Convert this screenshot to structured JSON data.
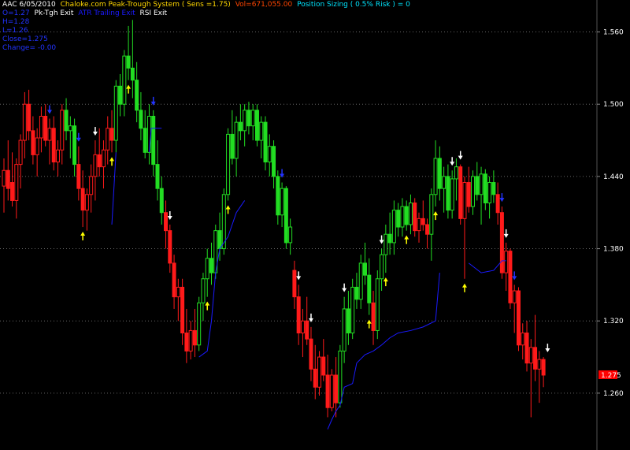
{
  "header": {
    "line1": {
      "symbol_date": "AAC 6/05/2010",
      "system": "Chaloke.com Peak-Trough System ( Sens =1.75)",
      "volume": "Vol=671,055.00",
      "sizing": "Position Sizing ( 0.5% Risk ) = 0"
    },
    "line2": {
      "o": "O=1.27",
      "pk_exit": "Pk-Tgh Exit",
      "atr_exit": "ATR Trailing Exit",
      "rsi_exit": "RSI Exit"
    },
    "ohlc": [
      "H=1.28",
      "L=1.26",
      "Close=1.275",
      "Change= -0.00"
    ]
  },
  "colors": {
    "background": "#000000",
    "up": "#22dd22",
    "down": "#ff1a1a",
    "trail": "#1a1aff",
    "buy_arrow": "#ffff00",
    "sell_arrow": "#ffffff",
    "blue_arrow": "#2233ff",
    "grid": "#666666",
    "last_price_box": "#ff0000"
  },
  "chart_data": {
    "type": "candlestick",
    "ylim": [
      1.22,
      1.58
    ],
    "y_ticks": [
      "1.560",
      "1.500",
      "1.440",
      "1.380",
      "1.320",
      "1.260"
    ],
    "grid": "dotted horizontal at ticks",
    "last_price": "1.275",
    "candles": [
      {
        "o": 1.432,
        "h": 1.455,
        "l": 1.41,
        "c": 1.445,
        "d": "down"
      },
      {
        "o": 1.445,
        "h": 1.47,
        "l": 1.42,
        "c": 1.43,
        "d": "down"
      },
      {
        "o": 1.435,
        "h": 1.46,
        "l": 1.415,
        "c": 1.42,
        "d": "down"
      },
      {
        "o": 1.42,
        "h": 1.455,
        "l": 1.405,
        "c": 1.45,
        "d": "down"
      },
      {
        "o": 1.45,
        "h": 1.475,
        "l": 1.43,
        "c": 1.47,
        "d": "down"
      },
      {
        "o": 1.47,
        "h": 1.51,
        "l": 1.455,
        "c": 1.5,
        "d": "down"
      },
      {
        "o": 1.5,
        "h": 1.512,
        "l": 1.47,
        "c": 1.478,
        "d": "down"
      },
      {
        "o": 1.478,
        "h": 1.49,
        "l": 1.45,
        "c": 1.458,
        "d": "down"
      },
      {
        "o": 1.458,
        "h": 1.48,
        "l": 1.44,
        "c": 1.472,
        "d": "down"
      },
      {
        "o": 1.472,
        "h": 1.498,
        "l": 1.46,
        "c": 1.49,
        "d": "down"
      },
      {
        "o": 1.49,
        "h": 1.5,
        "l": 1.465,
        "c": 1.47,
        "d": "down"
      },
      {
        "o": 1.47,
        "h": 1.488,
        "l": 1.45,
        "c": 1.48,
        "d": "down"
      },
      {
        "o": 1.48,
        "h": 1.49,
        "l": 1.445,
        "c": 1.452,
        "d": "down"
      },
      {
        "o": 1.452,
        "h": 1.47,
        "l": 1.44,
        "c": 1.462,
        "d": "down"
      },
      {
        "o": 1.462,
        "h": 1.5,
        "l": 1.45,
        "c": 1.495,
        "d": "down"
      },
      {
        "o": 1.495,
        "h": 1.505,
        "l": 1.47,
        "c": 1.478,
        "d": "up"
      },
      {
        "o": 1.478,
        "h": 1.49,
        "l": 1.455,
        "c": 1.482,
        "d": "up"
      },
      {
        "o": 1.482,
        "h": 1.488,
        "l": 1.44,
        "c": 1.45,
        "d": "up"
      },
      {
        "o": 1.45,
        "h": 1.465,
        "l": 1.42,
        "c": 1.43,
        "d": "down"
      },
      {
        "o": 1.43,
        "h": 1.445,
        "l": 1.398,
        "c": 1.412,
        "d": "down"
      },
      {
        "o": 1.412,
        "h": 1.43,
        "l": 1.395,
        "c": 1.425,
        "d": "down"
      },
      {
        "o": 1.425,
        "h": 1.45,
        "l": 1.41,
        "c": 1.44,
        "d": "down"
      },
      {
        "o": 1.44,
        "h": 1.47,
        "l": 1.42,
        "c": 1.458,
        "d": "down"
      },
      {
        "o": 1.458,
        "h": 1.48,
        "l": 1.44,
        "c": 1.448,
        "d": "down"
      },
      {
        "o": 1.448,
        "h": 1.47,
        "l": 1.43,
        "c": 1.462,
        "d": "down"
      },
      {
        "o": 1.462,
        "h": 1.49,
        "l": 1.45,
        "c": 1.48,
        "d": "down"
      },
      {
        "o": 1.48,
        "h": 1.495,
        "l": 1.46,
        "c": 1.47,
        "d": "down"
      },
      {
        "o": 1.47,
        "h": 1.52,
        "l": 1.46,
        "c": 1.515,
        "d": "up"
      },
      {
        "o": 1.515,
        "h": 1.525,
        "l": 1.49,
        "c": 1.5,
        "d": "up"
      },
      {
        "o": 1.5,
        "h": 1.545,
        "l": 1.49,
        "c": 1.54,
        "d": "up"
      },
      {
        "o": 1.54,
        "h": 1.565,
        "l": 1.52,
        "c": 1.53,
        "d": "up"
      },
      {
        "o": 1.53,
        "h": 1.57,
        "l": 1.505,
        "c": 1.52,
        "d": "up"
      },
      {
        "o": 1.52,
        "h": 1.535,
        "l": 1.485,
        "c": 1.495,
        "d": "up"
      },
      {
        "o": 1.495,
        "h": 1.51,
        "l": 1.47,
        "c": 1.48,
        "d": "up"
      },
      {
        "o": 1.48,
        "h": 1.495,
        "l": 1.455,
        "c": 1.46,
        "d": "up"
      },
      {
        "o": 1.46,
        "h": 1.5,
        "l": 1.45,
        "c": 1.49,
        "d": "up"
      },
      {
        "o": 1.49,
        "h": 1.495,
        "l": 1.44,
        "c": 1.45,
        "d": "up"
      },
      {
        "o": 1.45,
        "h": 1.47,
        "l": 1.42,
        "c": 1.43,
        "d": "up"
      },
      {
        "o": 1.43,
        "h": 1.44,
        "l": 1.4,
        "c": 1.41,
        "d": "up"
      },
      {
        "o": 1.41,
        "h": 1.42,
        "l": 1.38,
        "c": 1.395,
        "d": "down"
      },
      {
        "o": 1.395,
        "h": 1.4,
        "l": 1.36,
        "c": 1.368,
        "d": "down"
      },
      {
        "o": 1.368,
        "h": 1.375,
        "l": 1.33,
        "c": 1.34,
        "d": "down"
      },
      {
        "o": 1.34,
        "h": 1.355,
        "l": 1.32,
        "c": 1.348,
        "d": "down"
      },
      {
        "o": 1.348,
        "h": 1.355,
        "l": 1.3,
        "c": 1.31,
        "d": "down"
      },
      {
        "o": 1.31,
        "h": 1.33,
        "l": 1.285,
        "c": 1.295,
        "d": "down"
      },
      {
        "o": 1.295,
        "h": 1.32,
        "l": 1.288,
        "c": 1.312,
        "d": "down"
      },
      {
        "o": 1.312,
        "h": 1.33,
        "l": 1.29,
        "c": 1.3,
        "d": "down"
      },
      {
        "o": 1.3,
        "h": 1.34,
        "l": 1.295,
        "c": 1.335,
        "d": "up"
      },
      {
        "o": 1.335,
        "h": 1.36,
        "l": 1.32,
        "c": 1.355,
        "d": "up"
      },
      {
        "o": 1.355,
        "h": 1.38,
        "l": 1.34,
        "c": 1.372,
        "d": "up"
      },
      {
        "o": 1.372,
        "h": 1.385,
        "l": 1.35,
        "c": 1.36,
        "d": "up"
      },
      {
        "o": 1.36,
        "h": 1.4,
        "l": 1.355,
        "c": 1.395,
        "d": "up"
      },
      {
        "o": 1.395,
        "h": 1.41,
        "l": 1.37,
        "c": 1.38,
        "d": "up"
      },
      {
        "o": 1.38,
        "h": 1.43,
        "l": 1.375,
        "c": 1.425,
        "d": "up"
      },
      {
        "o": 1.425,
        "h": 1.48,
        "l": 1.42,
        "c": 1.475,
        "d": "up"
      },
      {
        "o": 1.475,
        "h": 1.495,
        "l": 1.45,
        "c": 1.455,
        "d": "up"
      },
      {
        "o": 1.455,
        "h": 1.49,
        "l": 1.44,
        "c": 1.485,
        "d": "up"
      },
      {
        "o": 1.485,
        "h": 1.5,
        "l": 1.47,
        "c": 1.478,
        "d": "up"
      },
      {
        "o": 1.478,
        "h": 1.5,
        "l": 1.465,
        "c": 1.495,
        "d": "up"
      },
      {
        "o": 1.495,
        "h": 1.502,
        "l": 1.475,
        "c": 1.482,
        "d": "up"
      },
      {
        "o": 1.482,
        "h": 1.5,
        "l": 1.47,
        "c": 1.495,
        "d": "up"
      },
      {
        "o": 1.495,
        "h": 1.5,
        "l": 1.465,
        "c": 1.47,
        "d": "up"
      },
      {
        "o": 1.47,
        "h": 1.49,
        "l": 1.455,
        "c": 1.485,
        "d": "up"
      },
      {
        "o": 1.485,
        "h": 1.49,
        "l": 1.445,
        "c": 1.452,
        "d": "up"
      },
      {
        "o": 1.452,
        "h": 1.475,
        "l": 1.44,
        "c": 1.465,
        "d": "up"
      },
      {
        "o": 1.465,
        "h": 1.47,
        "l": 1.43,
        "c": 1.44,
        "d": "up"
      },
      {
        "o": 1.44,
        "h": 1.445,
        "l": 1.4,
        "c": 1.408,
        "d": "up"
      },
      {
        "o": 1.408,
        "h": 1.435,
        "l": 1.398,
        "c": 1.43,
        "d": "up"
      },
      {
        "o": 1.43,
        "h": 1.432,
        "l": 1.38,
        "c": 1.385,
        "d": "up"
      },
      {
        "o": 1.385,
        "h": 1.405,
        "l": 1.375,
        "c": 1.398,
        "d": "up"
      },
      {
        "o": 1.362,
        "h": 1.37,
        "l": 1.33,
        "c": 1.34,
        "d": "down"
      },
      {
        "o": 1.34,
        "h": 1.35,
        "l": 1.3,
        "c": 1.31,
        "d": "down"
      },
      {
        "o": 1.31,
        "h": 1.33,
        "l": 1.29,
        "c": 1.32,
        "d": "down"
      },
      {
        "o": 1.32,
        "h": 1.34,
        "l": 1.3,
        "c": 1.305,
        "d": "down"
      },
      {
        "o": 1.305,
        "h": 1.315,
        "l": 1.27,
        "c": 1.28,
        "d": "down"
      },
      {
        "o": 1.28,
        "h": 1.3,
        "l": 1.255,
        "c": 1.265,
        "d": "down"
      },
      {
        "o": 1.265,
        "h": 1.295,
        "l": 1.258,
        "c": 1.29,
        "d": "down"
      },
      {
        "o": 1.29,
        "h": 1.305,
        "l": 1.27,
        "c": 1.275,
        "d": "down"
      },
      {
        "o": 1.275,
        "h": 1.292,
        "l": 1.24,
        "c": 1.248,
        "d": "down"
      },
      {
        "o": 1.248,
        "h": 1.28,
        "l": 1.245,
        "c": 1.275,
        "d": "down"
      },
      {
        "o": 1.275,
        "h": 1.29,
        "l": 1.24,
        "c": 1.252,
        "d": "down"
      },
      {
        "o": 1.252,
        "h": 1.3,
        "l": 1.248,
        "c": 1.295,
        "d": "up"
      },
      {
        "o": 1.295,
        "h": 1.34,
        "l": 1.285,
        "c": 1.33,
        "d": "up"
      },
      {
        "o": 1.33,
        "h": 1.345,
        "l": 1.3,
        "c": 1.31,
        "d": "up"
      },
      {
        "o": 1.31,
        "h": 1.355,
        "l": 1.305,
        "c": 1.348,
        "d": "up"
      },
      {
        "o": 1.348,
        "h": 1.36,
        "l": 1.33,
        "c": 1.338,
        "d": "up"
      },
      {
        "o": 1.338,
        "h": 1.375,
        "l": 1.33,
        "c": 1.368,
        "d": "up"
      },
      {
        "o": 1.368,
        "h": 1.385,
        "l": 1.35,
        "c": 1.358,
        "d": "up"
      },
      {
        "o": 1.358,
        "h": 1.372,
        "l": 1.325,
        "c": 1.335,
        "d": "up"
      },
      {
        "o": 1.335,
        "h": 1.345,
        "l": 1.3,
        "c": 1.312,
        "d": "down"
      },
      {
        "o": 1.312,
        "h": 1.362,
        "l": 1.305,
        "c": 1.355,
        "d": "up"
      },
      {
        "o": 1.355,
        "h": 1.38,
        "l": 1.345,
        "c": 1.375,
        "d": "up"
      },
      {
        "o": 1.375,
        "h": 1.4,
        "l": 1.36,
        "c": 1.392,
        "d": "up"
      },
      {
        "o": 1.392,
        "h": 1.41,
        "l": 1.375,
        "c": 1.385,
        "d": "up"
      },
      {
        "o": 1.385,
        "h": 1.42,
        "l": 1.375,
        "c": 1.412,
        "d": "up"
      },
      {
        "o": 1.412,
        "h": 1.418,
        "l": 1.39,
        "c": 1.398,
        "d": "up"
      },
      {
        "o": 1.398,
        "h": 1.422,
        "l": 1.39,
        "c": 1.415,
        "d": "up"
      },
      {
        "o": 1.415,
        "h": 1.42,
        "l": 1.395,
        "c": 1.4,
        "d": "up"
      },
      {
        "o": 1.4,
        "h": 1.425,
        "l": 1.392,
        "c": 1.418,
        "d": "up"
      },
      {
        "o": 1.418,
        "h": 1.422,
        "l": 1.39,
        "c": 1.395,
        "d": "down"
      },
      {
        "o": 1.395,
        "h": 1.41,
        "l": 1.385,
        "c": 1.405,
        "d": "down"
      },
      {
        "o": 1.405,
        "h": 1.42,
        "l": 1.395,
        "c": 1.4,
        "d": "down"
      },
      {
        "o": 1.4,
        "h": 1.405,
        "l": 1.38,
        "c": 1.392,
        "d": "down"
      },
      {
        "o": 1.392,
        "h": 1.43,
        "l": 1.37,
        "c": 1.425,
        "d": "up"
      },
      {
        "o": 1.425,
        "h": 1.47,
        "l": 1.415,
        "c": 1.455,
        "d": "up"
      },
      {
        "o": 1.455,
        "h": 1.465,
        "l": 1.42,
        "c": 1.43,
        "d": "up"
      },
      {
        "o": 1.43,
        "h": 1.448,
        "l": 1.41,
        "c": 1.44,
        "d": "up"
      },
      {
        "o": 1.44,
        "h": 1.45,
        "l": 1.405,
        "c": 1.412,
        "d": "up"
      },
      {
        "o": 1.412,
        "h": 1.445,
        "l": 1.405,
        "c": 1.438,
        "d": "up"
      },
      {
        "o": 1.438,
        "h": 1.455,
        "l": 1.42,
        "c": 1.448,
        "d": "up"
      },
      {
        "o": 1.448,
        "h": 1.45,
        "l": 1.4,
        "c": 1.405,
        "d": "down"
      },
      {
        "o": 1.405,
        "h": 1.44,
        "l": 1.355,
        "c": 1.435,
        "d": "down"
      },
      {
        "o": 1.435,
        "h": 1.448,
        "l": 1.41,
        "c": 1.415,
        "d": "down"
      },
      {
        "o": 1.415,
        "h": 1.445,
        "l": 1.408,
        "c": 1.44,
        "d": "up"
      },
      {
        "o": 1.44,
        "h": 1.452,
        "l": 1.42,
        "c": 1.425,
        "d": "up"
      },
      {
        "o": 1.425,
        "h": 1.448,
        "l": 1.4,
        "c": 1.442,
        "d": "up"
      },
      {
        "o": 1.442,
        "h": 1.446,
        "l": 1.412,
        "c": 1.418,
        "d": "up"
      },
      {
        "o": 1.418,
        "h": 1.44,
        "l": 1.405,
        "c": 1.435,
        "d": "up"
      },
      {
        "o": 1.435,
        "h": 1.445,
        "l": 1.418,
        "c": 1.425,
        "d": "up"
      },
      {
        "o": 1.425,
        "h": 1.435,
        "l": 1.4,
        "c": 1.41,
        "d": "down"
      },
      {
        "o": 1.41,
        "h": 1.415,
        "l": 1.355,
        "c": 1.36,
        "d": "down"
      },
      {
        "o": 1.36,
        "h": 1.385,
        "l": 1.345,
        "c": 1.378,
        "d": "down"
      },
      {
        "o": 1.378,
        "h": 1.38,
        "l": 1.33,
        "c": 1.335,
        "d": "down"
      },
      {
        "o": 1.335,
        "h": 1.35,
        "l": 1.31,
        "c": 1.345,
        "d": "down"
      },
      {
        "o": 1.345,
        "h": 1.348,
        "l": 1.295,
        "c": 1.3,
        "d": "down"
      },
      {
        "o": 1.3,
        "h": 1.318,
        "l": 1.288,
        "c": 1.31,
        "d": "down"
      },
      {
        "o": 1.31,
        "h": 1.32,
        "l": 1.278,
        "c": 1.285,
        "d": "down"
      },
      {
        "o": 1.285,
        "h": 1.305,
        "l": 1.24,
        "c": 1.298,
        "d": "down"
      },
      {
        "o": 1.298,
        "h": 1.325,
        "l": 1.27,
        "c": 1.28,
        "d": "down"
      },
      {
        "o": 1.28,
        "h": 1.295,
        "l": 1.252,
        "c": 1.288,
        "d": "down"
      },
      {
        "o": 1.288,
        "h": 1.29,
        "l": 1.265,
        "c": 1.275,
        "d": "down"
      }
    ],
    "trailing_stop": [
      [
        0,
        1.4
      ],
      [
        26,
        1.4
      ],
      [
        27,
        1.46
      ],
      [
        35,
        1.46
      ],
      [
        35.5,
        1.48
      ],
      [
        38,
        1.48
      ],
      [
        47,
        1.29
      ],
      [
        49,
        1.295
      ],
      [
        50,
        1.32
      ],
      [
        51,
        1.36
      ],
      [
        52,
        1.38
      ],
      [
        53,
        1.385
      ],
      [
        54,
        1.39
      ],
      [
        55,
        1.4
      ],
      [
        56,
        1.41
      ],
      [
        58,
        1.42
      ],
      [
        65,
        1.42
      ],
      [
        78,
        1.23
      ],
      [
        79,
        1.238
      ],
      [
        80,
        1.245
      ],
      [
        81,
        1.25
      ],
      [
        82,
        1.265
      ],
      [
        84,
        1.268
      ],
      [
        85,
        1.285
      ],
      [
        87,
        1.292
      ],
      [
        89,
        1.295
      ],
      [
        91,
        1.3
      ],
      [
        93,
        1.306
      ],
      [
        95,
        1.31
      ],
      [
        98,
        1.312
      ],
      [
        101,
        1.315
      ],
      [
        104,
        1.32
      ],
      [
        105,
        1.36
      ],
      [
        112,
        1.368
      ],
      [
        115,
        1.36
      ],
      [
        118,
        1.362
      ],
      [
        120,
        1.37
      ],
      [
        121,
        1.37
      ]
    ],
    "arrows": [
      {
        "i": 11,
        "type": "blue-down",
        "side": "above"
      },
      {
        "i": 18,
        "type": "blue-down",
        "side": "above"
      },
      {
        "i": 36,
        "type": "blue-down",
        "side": "above"
      },
      {
        "i": 67,
        "type": "blue-down",
        "side": "above"
      },
      {
        "i": 120,
        "type": "blue-down",
        "side": "above"
      },
      {
        "i": 123,
        "type": "blue-down",
        "side": "above"
      },
      {
        "i": 19,
        "type": "yellow-up",
        "side": "below"
      },
      {
        "i": 26,
        "type": "yellow-up",
        "side": "below"
      },
      {
        "i": 30,
        "type": "yellow-up",
        "side": "below"
      },
      {
        "i": 49,
        "type": "yellow-up",
        "side": "below"
      },
      {
        "i": 54,
        "type": "yellow-up",
        "side": "below"
      },
      {
        "i": 88,
        "type": "yellow-up",
        "side": "below"
      },
      {
        "i": 92,
        "type": "yellow-up",
        "side": "below"
      },
      {
        "i": 97,
        "type": "yellow-up",
        "side": "below"
      },
      {
        "i": 104,
        "type": "yellow-up",
        "side": "below"
      },
      {
        "i": 111,
        "type": "yellow-up",
        "side": "below"
      },
      {
        "i": 22,
        "type": "white-down",
        "side": "above"
      },
      {
        "i": 40,
        "type": "white-down",
        "side": "above"
      },
      {
        "i": 71,
        "type": "white-down",
        "side": "above"
      },
      {
        "i": 74,
        "type": "white-down",
        "side": "above"
      },
      {
        "i": 82,
        "type": "white-down",
        "side": "above"
      },
      {
        "i": 91,
        "type": "white-down",
        "side": "above"
      },
      {
        "i": 108,
        "type": "white-down",
        "side": "above"
      },
      {
        "i": 110,
        "type": "white-down",
        "side": "above"
      },
      {
        "i": 121,
        "type": "white-down",
        "side": "above"
      },
      {
        "i": 131,
        "type": "white-down",
        "side": "above"
      }
    ]
  }
}
